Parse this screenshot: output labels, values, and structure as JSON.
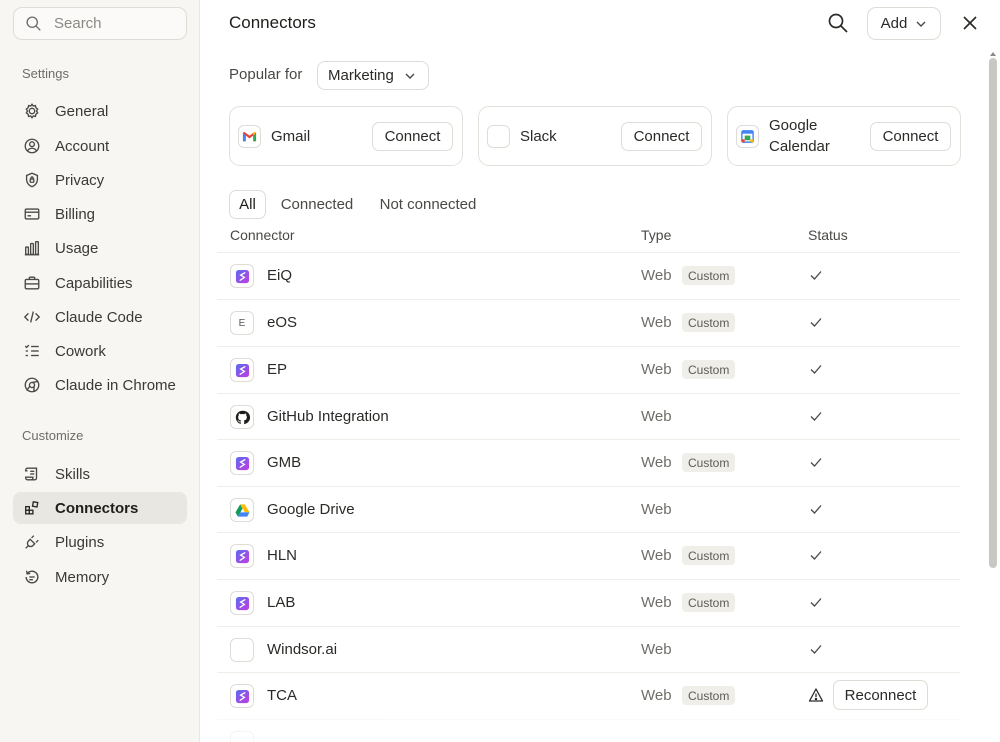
{
  "sidebar": {
    "search_placeholder": "Search",
    "settings_label": "Settings",
    "settings_items": [
      {
        "label": "General",
        "icon": "gear-icon"
      },
      {
        "label": "Account",
        "icon": "user-circle-icon"
      },
      {
        "label": "Privacy",
        "icon": "shield-icon"
      },
      {
        "label": "Billing",
        "icon": "credit-card-icon"
      },
      {
        "label": "Usage",
        "icon": "bar-chart-icon"
      },
      {
        "label": "Capabilities",
        "icon": "briefcase-icon"
      },
      {
        "label": "Claude Code",
        "icon": "code-icon"
      },
      {
        "label": "Cowork",
        "icon": "checklist-icon"
      },
      {
        "label": "Claude in Chrome",
        "icon": "globe-icon"
      }
    ],
    "customize_label": "Customize",
    "customize_items": [
      {
        "label": "Skills",
        "icon": "scroll-icon"
      },
      {
        "label": "Connectors",
        "icon": "blocks-icon",
        "active": true
      },
      {
        "label": "Plugins",
        "icon": "plug-icon"
      },
      {
        "label": "Memory",
        "icon": "history-icon"
      }
    ]
  },
  "header": {
    "title": "Connectors",
    "add_label": "Add"
  },
  "popular": {
    "label": "Popular for",
    "selected": "Marketing",
    "cards": [
      {
        "name": "Gmail",
        "button": "Connect",
        "icon": "gmail-icon"
      },
      {
        "name": "Slack",
        "button": "Connect",
        "icon": "slack-icon"
      },
      {
        "name": "Google Calendar",
        "button": "Connect",
        "icon": "google-calendar-icon"
      }
    ]
  },
  "filters": {
    "tabs": [
      "All",
      "Connected",
      "Not connected"
    ],
    "active": "All"
  },
  "table": {
    "headers": {
      "connector": "Connector",
      "type": "Type",
      "status": "Status"
    },
    "rows": [
      {
        "name": "EiQ",
        "type": "Web",
        "badge": "Custom",
        "status": "connected",
        "icon": "custom-connector-icon"
      },
      {
        "name": "eOS",
        "type": "Web",
        "badge": "Custom",
        "status": "connected",
        "icon": "letter-e-icon",
        "icon_text": "E"
      },
      {
        "name": "EP",
        "type": "Web",
        "badge": "Custom",
        "status": "connected",
        "icon": "custom-connector-icon"
      },
      {
        "name": "GitHub Integration",
        "type": "Web",
        "badge": "",
        "status": "connected",
        "icon": "github-icon"
      },
      {
        "name": "GMB",
        "type": "Web",
        "badge": "Custom",
        "status": "connected",
        "icon": "custom-connector-icon"
      },
      {
        "name": "Google Drive",
        "type": "Web",
        "badge": "",
        "status": "connected",
        "icon": "google-drive-icon"
      },
      {
        "name": "HLN",
        "type": "Web",
        "badge": "Custom",
        "status": "connected",
        "icon": "custom-connector-icon"
      },
      {
        "name": "LAB",
        "type": "Web",
        "badge": "Custom",
        "status": "connected",
        "icon": "custom-connector-icon"
      },
      {
        "name": "Windsor.ai",
        "type": "Web",
        "badge": "",
        "status": "connected",
        "icon": "windsor-icon"
      },
      {
        "name": "TCA",
        "type": "Web",
        "badge": "Custom",
        "status": "warning",
        "action": "Reconnect",
        "icon": "custom-connector-icon"
      }
    ]
  }
}
